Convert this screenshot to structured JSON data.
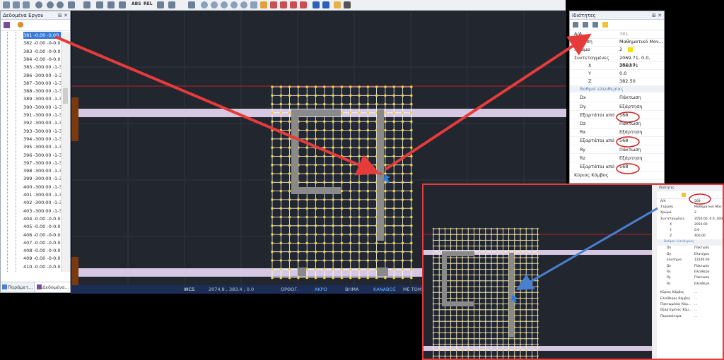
{
  "left_panel": {
    "title": "Δεδομένα Εργου",
    "nodes": [
      "381 -0.00 -0.00",
      "382 -0.00 -0-0.00",
      "383 -0.00 -0-0.00",
      "384 -0.00 -0-0.00",
      "385 -300.00 -1-3",
      "386 -300.00 -1-3",
      "387 -300.00 -1-3",
      "388 -300.00 -1-3",
      "389 -300.00 -1-3",
      "390 -300.00 -1-3",
      "391 -300.00 -1-3",
      "392 -300.00 -1-3",
      "393 -300.00 -1-3",
      "394 -300.00 -1-3",
      "395 -300.00 -1-3",
      "396 -300.00 -1-3",
      "397 -300.00 -1-3",
      "398 -300.00 -1-3",
      "399 -300.00 -1-3",
      "400 -300.00 -1-3",
      "401 -300.00 -1-3",
      "402 -300.00 -1-3",
      "403 -300.00 -1-3",
      "404 -0.00 -0-0.00",
      "405 -0.00 -0-0.00",
      "406 -0.00 -0-0.00",
      "407 -0.00 -0-0.00",
      "408 -0.00 -0-0.00",
      "409 -0.00 -0-0.00",
      "410 -0.00 -0-0.00",
      "411 -0.00 -0-0.00"
    ],
    "tabs": [
      "Παράμετ...",
      "Δεδομένα..."
    ]
  },
  "status_bar": {
    "coord_system": "WCS",
    "coords": "2074.8 , 383.4 , 0.0",
    "modes": [
      "ΟΡΘΟΓ.",
      "ΑΚΡΟ",
      "ΒΗΜΑ",
      "ΚΑΝΑΒΟΣ",
      "ΜΕ ΤΟΜ"
    ]
  },
  "toolbar": {
    "abs": "ABS",
    "rel": "REL"
  },
  "properties": {
    "title": "Ιδιότητες",
    "rows": [
      {
        "k": "Α/Α",
        "v": "381"
      },
      {
        "k": "Στρώση",
        "v": "Μαθηματικό Μον..."
      },
      {
        "k": "Χρώμα",
        "v": "2"
      },
      {
        "k": "Συντεταγμένες",
        "v": "2069.71, 0.0, 382.50"
      },
      {
        "k": "X",
        "v": "2069.71"
      },
      {
        "k": "Y",
        "v": "0.0"
      },
      {
        "k": "Z",
        "v": "382.50"
      }
    ],
    "section": "Βαθμοί ελευθερίας",
    "dof": [
      {
        "k": "Dx",
        "v": "Πάκτωση"
      },
      {
        "k": "Dy",
        "v": "Εξάρτηση"
      },
      {
        "k": "Εξαρτάται από",
        "v": "568"
      },
      {
        "k": "Dz",
        "v": "Πάκτωση"
      },
      {
        "k": "Rx",
        "v": "Εξάρτηση"
      },
      {
        "k": "Εξαρτάται από",
        "v": "568"
      },
      {
        "k": "Ry",
        "v": "Πάκτωση"
      },
      {
        "k": "Rz",
        "v": "Εξάρτηση"
      },
      {
        "k": "Εξαρτάται από",
        "v": "568"
      }
    ],
    "footer": "Κύριος Κόμβος"
  },
  "inset_properties": {
    "title": "Ιδιότητες",
    "rows": [
      {
        "k": "Α/Α",
        "v": "568"
      },
      {
        "k": "Στρώση",
        "v": "Μαθηματικό Μον"
      },
      {
        "k": "Χρώμα",
        "v": "2"
      },
      {
        "k": "Συντεταγμένες",
        "v": "2050.00, 0.0, 400"
      },
      {
        "k": "X",
        "v": "2050.00"
      },
      {
        "k": "Y",
        "v": "0.0"
      },
      {
        "k": "Z",
        "v": "400.00"
      }
    ],
    "section": "Βαθμοί ελευθερίας",
    "dof": [
      {
        "k": "Dx",
        "v": "Πάκτωση"
      },
      {
        "k": "Dy",
        "v": "Ελατήριο"
      },
      {
        "k": "Ελατήριο",
        "v": "12500.00"
      },
      {
        "k": "Dz",
        "v": "Πάκτωση"
      },
      {
        "k": "Rx",
        "v": "Ελεύθερο"
      },
      {
        "k": "Ry",
        "v": "Πάκτωση"
      },
      {
        "k": "Rz",
        "v": "Ελεύθερο"
      }
    ],
    "extra": [
      {
        "k": "Κύριος Κόμβος",
        "v": "..."
      },
      {
        "k": "Ελεύθερος Κόμβος",
        "v": "..."
      },
      {
        "k": "Πακτωμένος Κόμ...",
        "v": "..."
      },
      {
        "k": "Εξαρτημένος Κόμ...",
        "v": "..."
      },
      {
        "k": "Περισσότερα",
        "v": "..."
      }
    ]
  },
  "colors": {
    "highlight": "#e63b3b",
    "node": "#f2d13c",
    "canvas": "#22262f",
    "beam": "#d6c8e2",
    "arrow_blue": "#4b7fd0"
  }
}
